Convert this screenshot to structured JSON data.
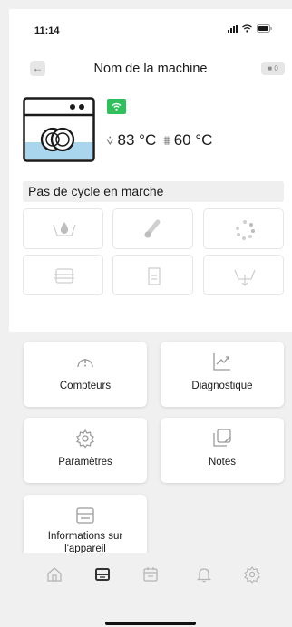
{
  "status_bar": {
    "time": "11:14"
  },
  "nav": {
    "back_label": "←",
    "title": "Nom de la machine",
    "badge_label": "0"
  },
  "machine": {
    "wifi_status_color": "#2fbf5b",
    "temp_1": "83 °C",
    "temp_2": "60 °C"
  },
  "cycle_status": "Pas de cycle en marche",
  "programs": [
    {
      "icon": "water-drop-basin-icon"
    },
    {
      "icon": "thermometer-icon"
    },
    {
      "icon": "rotating-cycle-icon"
    },
    {
      "icon": "drawer-icon"
    },
    {
      "icon": "cabinet-icon"
    },
    {
      "icon": "drain-arrow-icon"
    }
  ],
  "menu": {
    "counters": "Compteurs",
    "diagnostics": "Diagnostique",
    "settings": "Paramètres",
    "notes": "Notes",
    "device_info": "Informations sur l'appareil"
  },
  "tabs": [
    {
      "icon": "home-icon"
    },
    {
      "icon": "machine-icon",
      "active": true
    },
    {
      "icon": "calendar-icon"
    },
    {
      "icon": "bell-icon"
    },
    {
      "icon": "gear-icon"
    }
  ],
  "colors": {
    "accent_green": "#2fbf5b",
    "active_tab": "#333333",
    "inactive_tab": "#b5b5b5"
  }
}
